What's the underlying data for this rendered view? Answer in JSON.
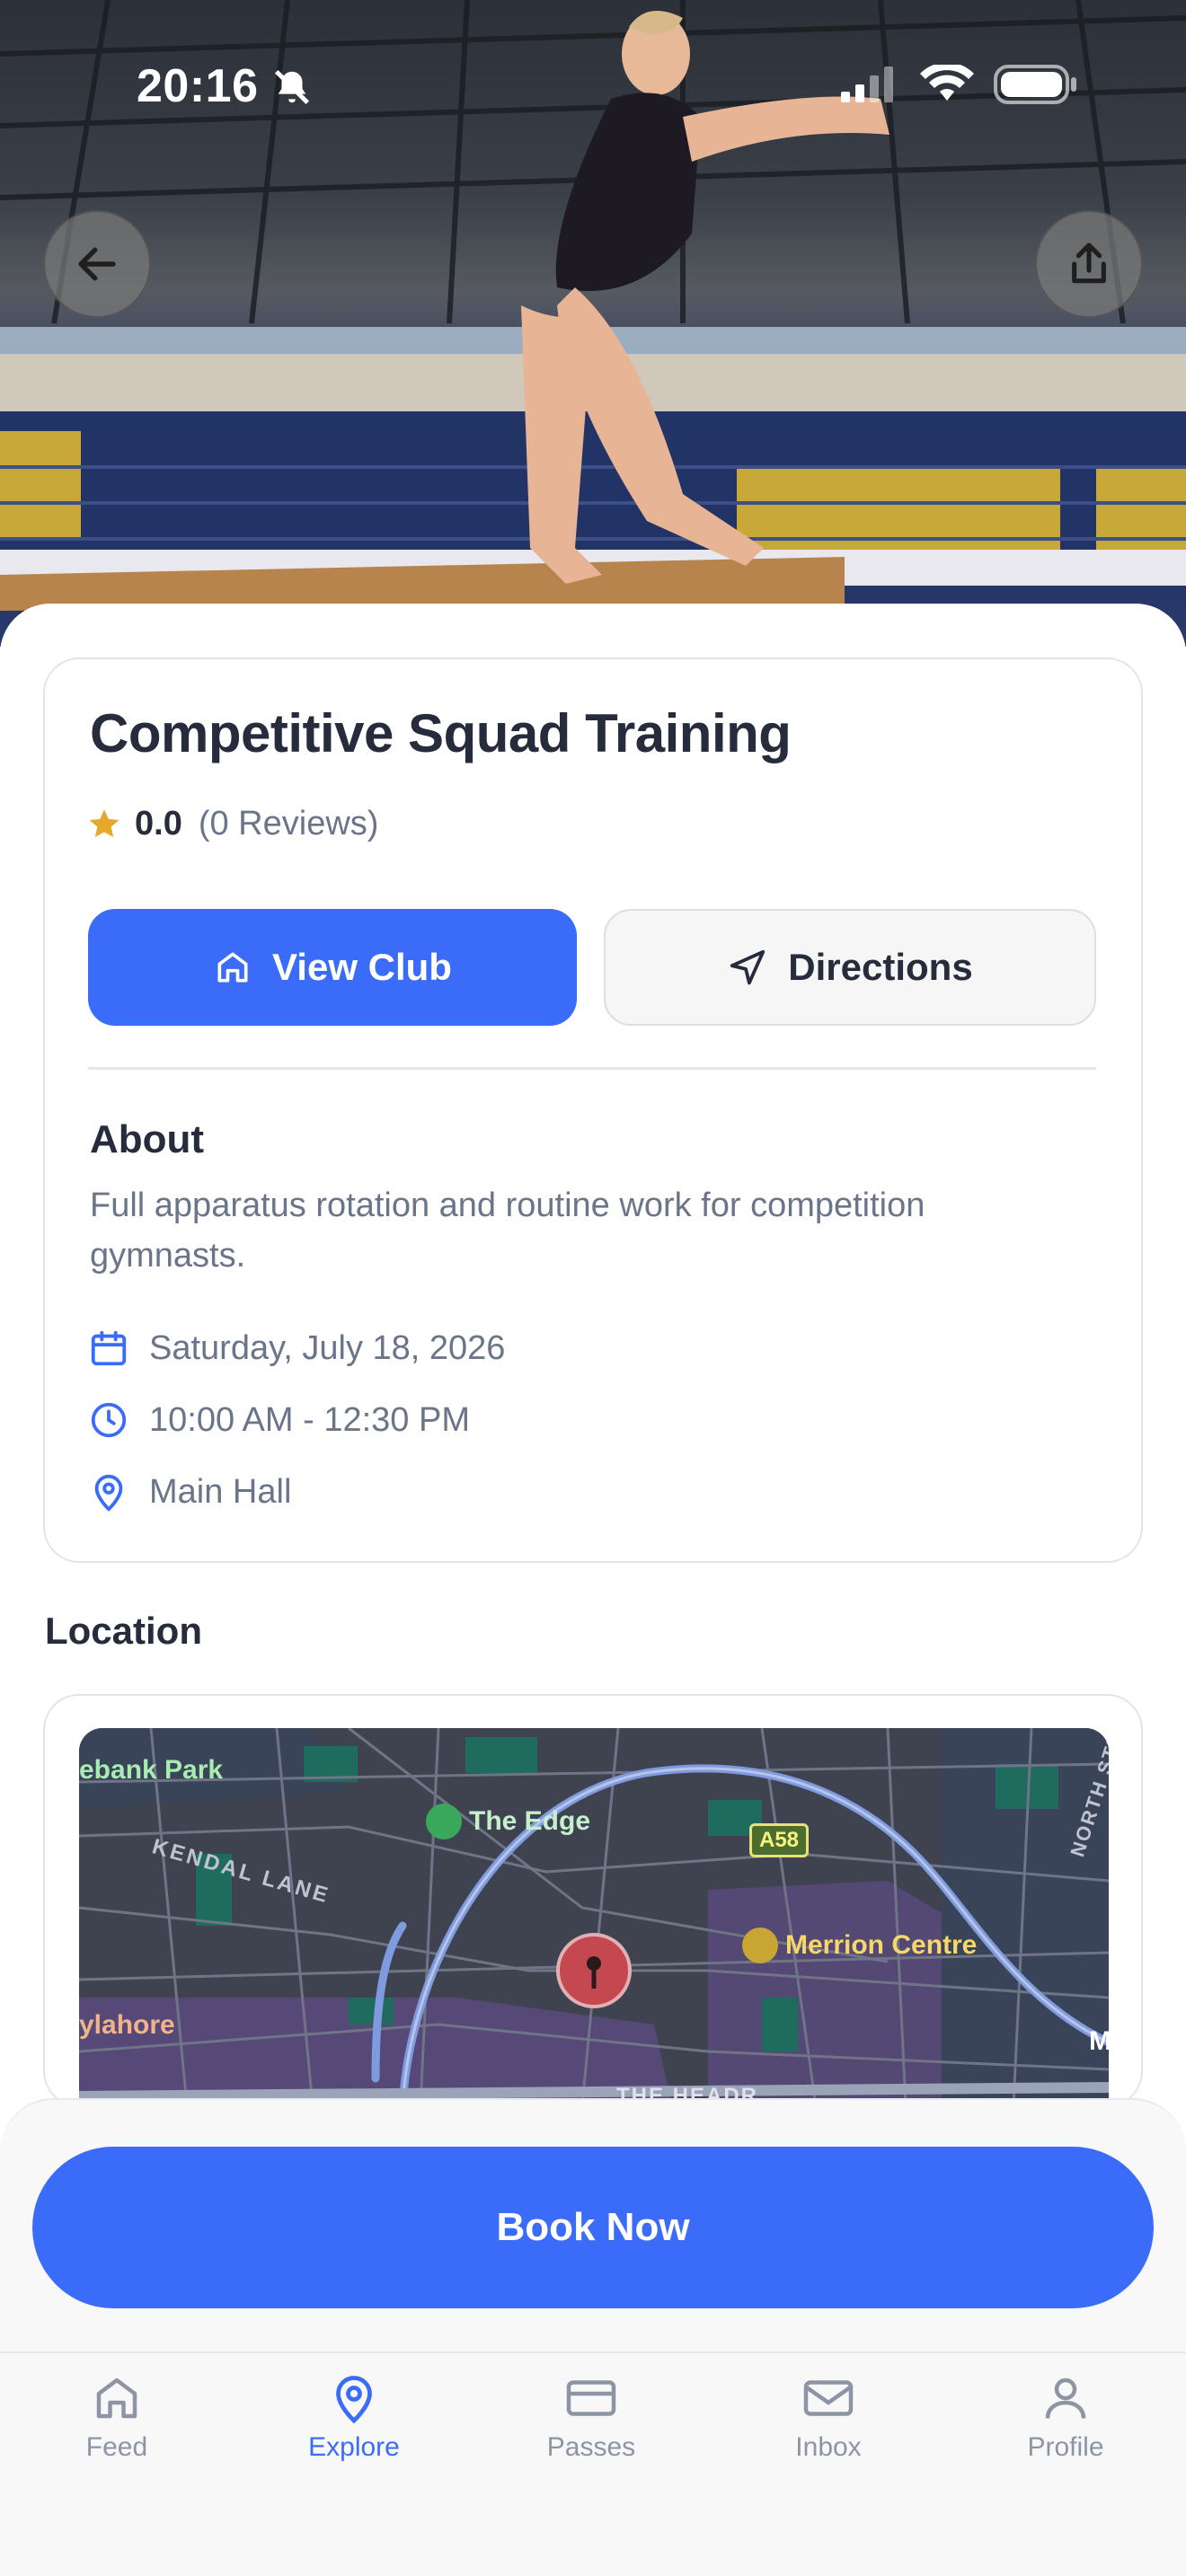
{
  "status_bar": {
    "time": "20:16"
  },
  "event": {
    "title": "Competitive Squad Training",
    "rating": "0.0",
    "reviews": "(0 Reviews)",
    "view_club_label": "View Club",
    "directions_label": "Directions",
    "about_heading": "About",
    "about_text": "Full apparatus rotation and routine work for competition gymnasts.",
    "date": "Saturday, July 18, 2026",
    "time": "10:00 AM - 12:30 PM",
    "place": "Main Hall"
  },
  "location": {
    "heading": "Location",
    "map_labels": {
      "park": "ebank Park",
      "poi_edge": "The Edge",
      "road_a58": "A58",
      "kendal": "KENDAL LANE",
      "merrion": "Merrion Centre",
      "north": "NORTH STR",
      "ylahore": "ylahore",
      "heads": "THE HEADR",
      "m_edge": "M"
    }
  },
  "book_label": "Book Now",
  "tabs": [
    {
      "label": "Feed",
      "icon": "home-icon",
      "active": false
    },
    {
      "label": "Explore",
      "icon": "map-pin-icon",
      "active": true
    },
    {
      "label": "Passes",
      "icon": "card-icon",
      "active": false
    },
    {
      "label": "Inbox",
      "icon": "mail-icon",
      "active": false
    },
    {
      "label": "Profile",
      "icon": "user-icon",
      "active": false
    }
  ],
  "colors": {
    "accent": "#3a6cf9",
    "star": "#e5a92a",
    "muted_text": "#6b7589"
  }
}
